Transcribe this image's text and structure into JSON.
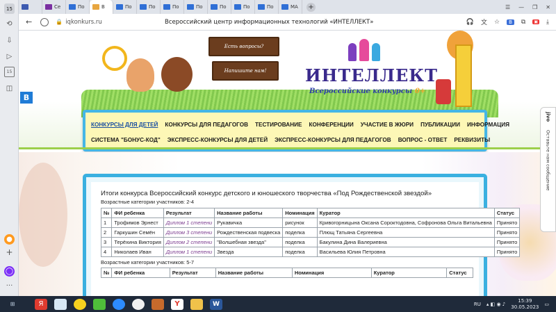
{
  "browser": {
    "tab_count": "15",
    "tabs": [
      {
        "label": "",
        "color": "#3c5ab0"
      },
      {
        "label": "Се",
        "color": "#7a2fa1"
      },
      {
        "label": "По",
        "color": "#2f6fd6"
      },
      {
        "label": "В",
        "color": "#e8a640",
        "active": true
      },
      {
        "label": "По",
        "color": "#2f6fd6"
      },
      {
        "label": "По",
        "color": "#2f6fd6"
      },
      {
        "label": "По",
        "color": "#2f6fd6"
      },
      {
        "label": "По",
        "color": "#2f6fd6"
      },
      {
        "label": "По",
        "color": "#2f6fd6"
      },
      {
        "label": "По",
        "color": "#2f6fd6"
      },
      {
        "label": "По",
        "color": "#2f6fd6"
      },
      {
        "label": "МА",
        "color": "#2f6fd6"
      }
    ],
    "url": "iqkonkurs.ru",
    "page_title": "Всероссийский центр информационных технологий «ИНТЕЛЛЕКТ»",
    "sidebar_badge": "15"
  },
  "header": {
    "sign1": "Есть вопросы?",
    "sign2": "Напишите нам!",
    "logo": "ИНТЕЛЛЕКТ",
    "logo_sub": "Всероссийские конкурсы",
    "logo_age": "0+"
  },
  "nav": {
    "row1": [
      "КОНКУРСЫ ДЛЯ ДЕТЕЙ",
      "КОНКУРСЫ ДЛЯ ПЕДАГОГОВ",
      "ТЕСТИРОВАНИЕ",
      "КОНФЕРЕНЦИИ",
      "УЧАСТИЕ В ЖЮРИ",
      "ПУБЛИКАЦИИ",
      "ИНФОРМАЦИЯ"
    ],
    "row2": [
      "СИСТЕМА \"БОНУС-КОД\"",
      "ЭКСПРЕСС-КОНКУРСЫ ДЛЯ ДЕТЕЙ",
      "ЭКСПРЕСС-КОНКУРСЫ ДЛЯ ПЕДАГОГОВ",
      "ВОПРОС - ОТВЕТ",
      "РЕКВИЗИТЫ"
    ]
  },
  "side_widget": {
    "text": "Оставьте нам сообщение",
    "brand": "jivo"
  },
  "content": {
    "title": "Итоги конкурса Всероссийский конкурс детского и юношеского творчества «Под Рождественской звездой»",
    "group1_label": "Возрастные категории участников: 2-4",
    "group2_label": "Возрастные категории участников: 5-7",
    "columns": [
      "№",
      "ФИ ребенка",
      "Результат",
      "Название работы",
      "Номинация",
      "Куратор",
      "Статус"
    ],
    "rows": [
      [
        "1",
        "Трофимов Эрнест",
        "Диплом 1 степени",
        "Рукавичка",
        "рисунок",
        "Кривогорницына Оксана Сороктодовна, Софронова Ольга Витальевна",
        "Принято"
      ],
      [
        "2",
        "Гаркушин Семён",
        "Диплом 3 степени",
        "Рождественская подвеска",
        "поделка",
        "Плющ Татьяна Сергеевна",
        "Принято"
      ],
      [
        "3",
        "Терёхина Виктория",
        "Диплом 2 степени",
        "\"Волшебная звезда\"",
        "поделка",
        "Бакулина Дина Валериевна",
        "Принято"
      ],
      [
        "4",
        "Николаев Иван",
        "Диплом 1 степени",
        "Звезда",
        "поделка",
        "Васильева Юлия Петровна",
        "Принято"
      ]
    ]
  },
  "taskbar": {
    "lang": "RU",
    "time": "15:39",
    "date": "30.05.2023"
  },
  "colors": {
    "nav_bg": "#fdf7b6",
    "nav_border": "#45b6e6",
    "content_border": "#3ab0e0",
    "accent_purple": "#7b3b8f"
  }
}
